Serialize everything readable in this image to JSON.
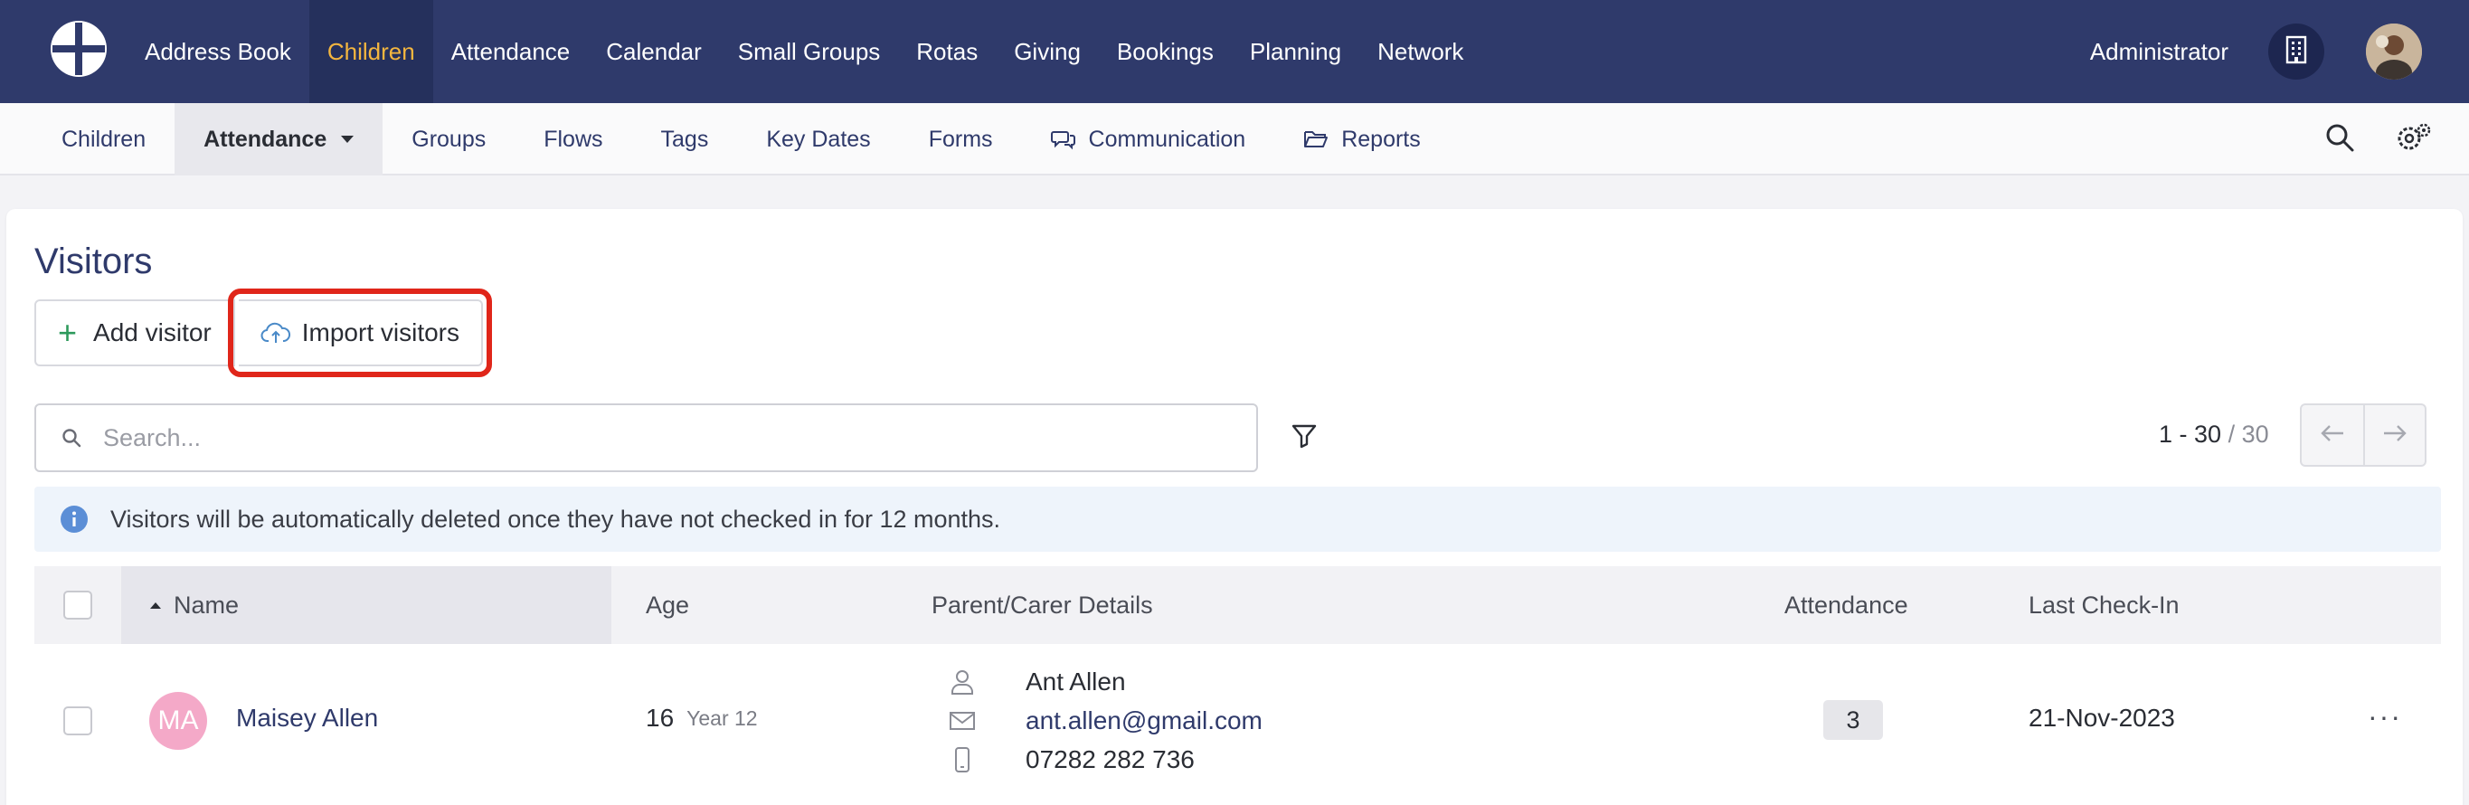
{
  "topnav": {
    "items": [
      {
        "label": "Address Book"
      },
      {
        "label": "Children",
        "active": true
      },
      {
        "label": "Attendance"
      },
      {
        "label": "Calendar"
      },
      {
        "label": "Small Groups"
      },
      {
        "label": "Rotas"
      },
      {
        "label": "Giving"
      },
      {
        "label": "Bookings"
      },
      {
        "label": "Planning"
      },
      {
        "label": "Network"
      }
    ],
    "user_label": "Administrator",
    "active_color": "#f4b63f",
    "bg_color": "#2f3a6b"
  },
  "subnav": {
    "items": [
      {
        "label": "Children"
      },
      {
        "label": "Attendance",
        "active": true
      },
      {
        "label": "Groups"
      },
      {
        "label": "Flows"
      },
      {
        "label": "Tags"
      },
      {
        "label": "Key Dates"
      },
      {
        "label": "Forms"
      },
      {
        "label": "Communication",
        "icon": "chat-bubbles-icon"
      },
      {
        "label": "Reports",
        "icon": "folder-open-icon"
      }
    ]
  },
  "page": {
    "title": "Visitors",
    "add_button": "Add visitor",
    "import_button": "Import visitors",
    "search_placeholder": "Search...",
    "pagination_range": "1 - 30",
    "pagination_total": "/ 30",
    "info_message": "Visitors will be automatically deleted once they have not checked in for 12 months."
  },
  "table": {
    "columns": {
      "name": "Name",
      "age": "Age",
      "parent": "Parent/Carer Details",
      "attendance": "Attendance",
      "last_checkin": "Last Check-In"
    },
    "rows": [
      {
        "initials": "MA",
        "name": "Maisey Allen",
        "age": "16",
        "year": "Year 12",
        "parent_name": "Ant Allen",
        "parent_email": "ant.allen@gmail.com",
        "parent_phone": "07282 282 736",
        "attendance": "3",
        "last_checkin": "21-Nov-2023",
        "more": "···"
      }
    ]
  }
}
